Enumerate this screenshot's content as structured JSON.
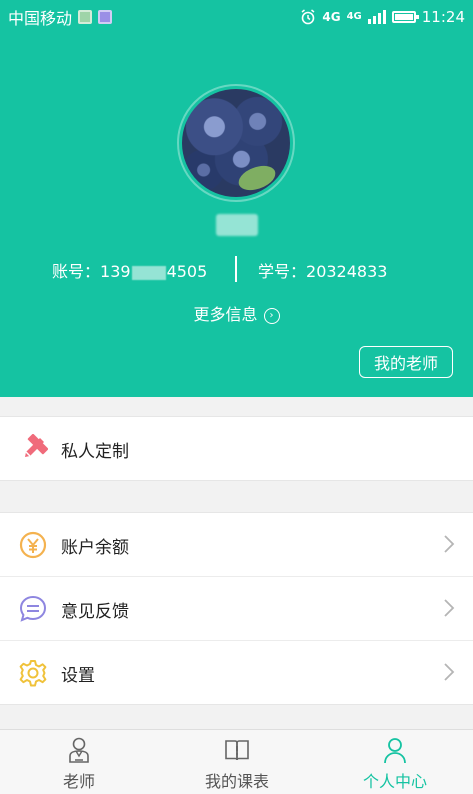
{
  "status_bar": {
    "carrier": "中国移动",
    "network_a": "4G",
    "network_b": "4G",
    "time": "11:24",
    "icons": [
      "image-notification-icon",
      "app-notification-icon",
      "alarm-icon",
      "signal-icon",
      "battery-icon"
    ]
  },
  "profile": {
    "account_label": "账号：",
    "account_prefix": "139",
    "account_suffix": "4505",
    "student_label": "学号：",
    "student_id": "20324833",
    "more_info": "更多信息",
    "my_teacher_button": "我的老师"
  },
  "menu": {
    "custom": {
      "label": "私人定制",
      "icon": "pencil-ruler-icon",
      "color": "#f06b7b"
    },
    "items": [
      {
        "label": "账户余额",
        "icon": "yuan-coin-icon",
        "color": "#f4b24f"
      },
      {
        "label": "意见反馈",
        "icon": "feedback-bubble-icon",
        "color": "#8e86e0"
      },
      {
        "label": "设置",
        "icon": "gear-icon",
        "color": "#f0c23a"
      }
    ]
  },
  "tabs": [
    {
      "label": "老师",
      "icon": "teacher-icon",
      "active": false
    },
    {
      "label": "我的课表",
      "icon": "book-icon",
      "active": false
    },
    {
      "label": "个人中心",
      "icon": "person-icon",
      "active": true
    }
  ],
  "colors": {
    "accent": "#15c3a2",
    "inactive": "#555555"
  }
}
